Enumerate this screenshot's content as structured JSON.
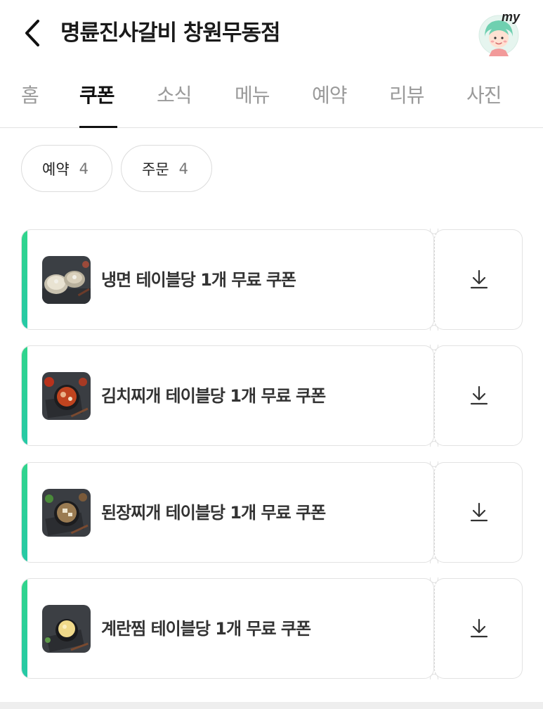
{
  "header": {
    "title": "명륜진사갈비 창원무동점",
    "back_icon": "chevron-left-icon",
    "avatar_label": "my"
  },
  "tabs": [
    {
      "label": "홈",
      "active": false
    },
    {
      "label": "쿠폰",
      "active": true
    },
    {
      "label": "소식",
      "active": false
    },
    {
      "label": "메뉴",
      "active": false
    },
    {
      "label": "예약",
      "active": false
    },
    {
      "label": "리뷰",
      "active": false
    },
    {
      "label": "사진",
      "active": false
    }
  ],
  "filters": [
    {
      "label": "예약",
      "count": "4"
    },
    {
      "label": "주문",
      "count": "4"
    }
  ],
  "coupons": [
    {
      "name": "냉면 테이블당 1개 무료 쿠폰",
      "icon": "download-icon"
    },
    {
      "name": "김치찌개 테이블당 1개 무료 쿠폰",
      "icon": "download-icon"
    },
    {
      "name": "된장찌개 테이블당 1개 무료 쿠폰",
      "icon": "download-icon"
    },
    {
      "name": "계란찜 테이블당 1개 무료 쿠폰",
      "icon": "download-icon"
    }
  ],
  "colors": {
    "accent_top": "#30d58c",
    "accent_bottom": "#26c9a6",
    "tab_active": "#111111",
    "tab_inactive": "#9a9a9a"
  }
}
